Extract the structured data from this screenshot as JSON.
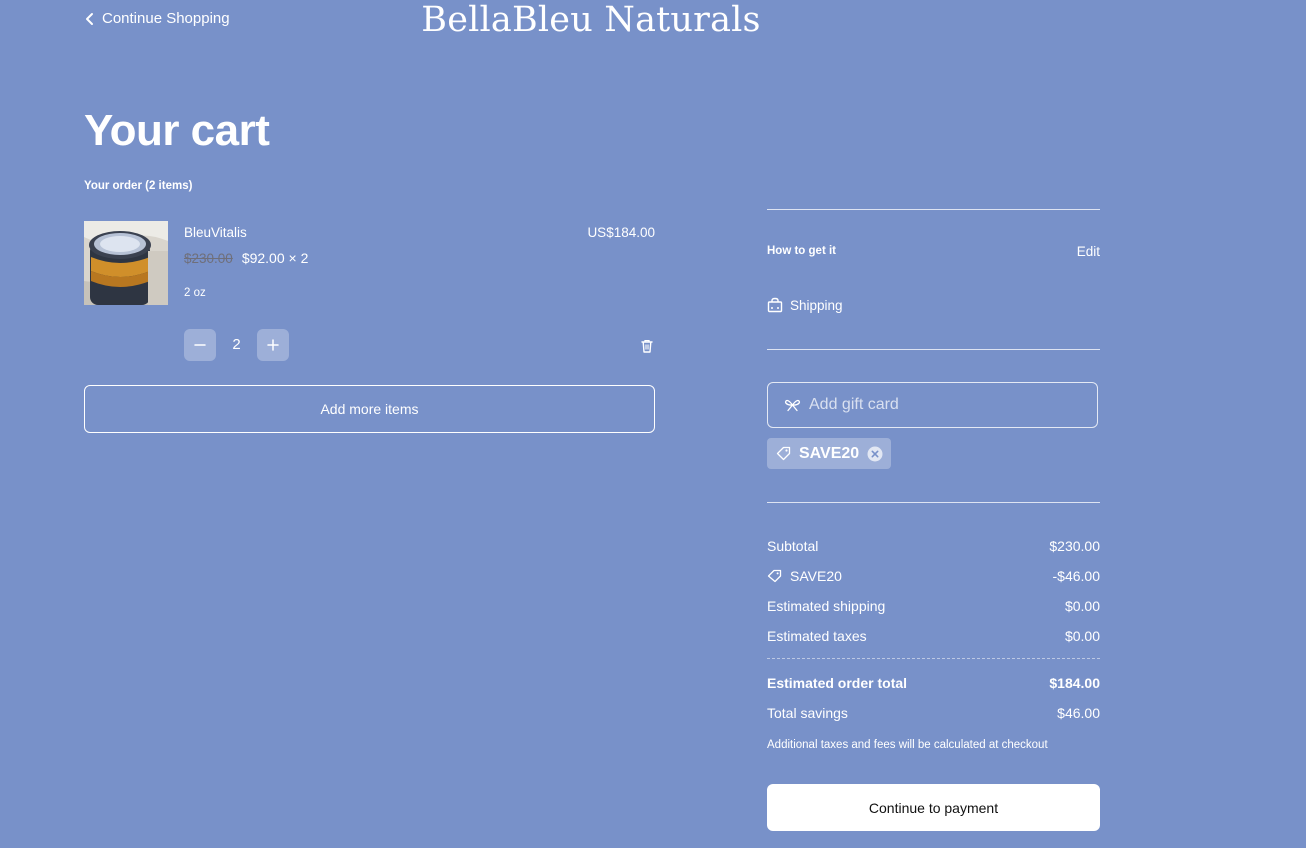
{
  "header": {
    "back_label": "Continue Shopping",
    "brand": "BellaBleu Naturals"
  },
  "page_title": "Your cart",
  "order_count": "Your order (2 items)",
  "cart": {
    "items": [
      {
        "name": "BleuVitalis",
        "price_original": "$230.00",
        "price_each": "$92.00 × 2",
        "variant": "2 oz",
        "quantity": "2",
        "line_total": "US$184.00",
        "thumbnail_icon": "product-jar-photo"
      }
    ],
    "add_more_label": "Add more items"
  },
  "fulfillment": {
    "label": "How to get it",
    "edit_label": "Edit",
    "method": "Shipping",
    "method_icon": "shipping-box-icon"
  },
  "gift_card": {
    "placeholder": "Add gift card",
    "icon": "gift-icon"
  },
  "promo_chip": {
    "code": "SAVE20",
    "icon": "tag-icon",
    "remove_icon": "close-circle-icon"
  },
  "summary": {
    "subtotal_label": "Subtotal",
    "subtotal_value": "$230.00",
    "discount_label": "SAVE20",
    "discount_value": "-$46.00",
    "shipping_label": "Estimated shipping",
    "shipping_value": "$0.00",
    "taxes_label": "Estimated taxes",
    "taxes_value": "$0.00",
    "total_label": "Estimated order total",
    "total_value": "$184.00",
    "savings_label": "Total savings",
    "savings_value": "$46.00",
    "note": "Additional taxes and fees will be calculated at checkout"
  },
  "checkout_button": "Continue to payment",
  "colors": {
    "background": "#7891c9",
    "text": "#ffffff",
    "button_bg": "#ffffff",
    "button_text": "#111111"
  }
}
